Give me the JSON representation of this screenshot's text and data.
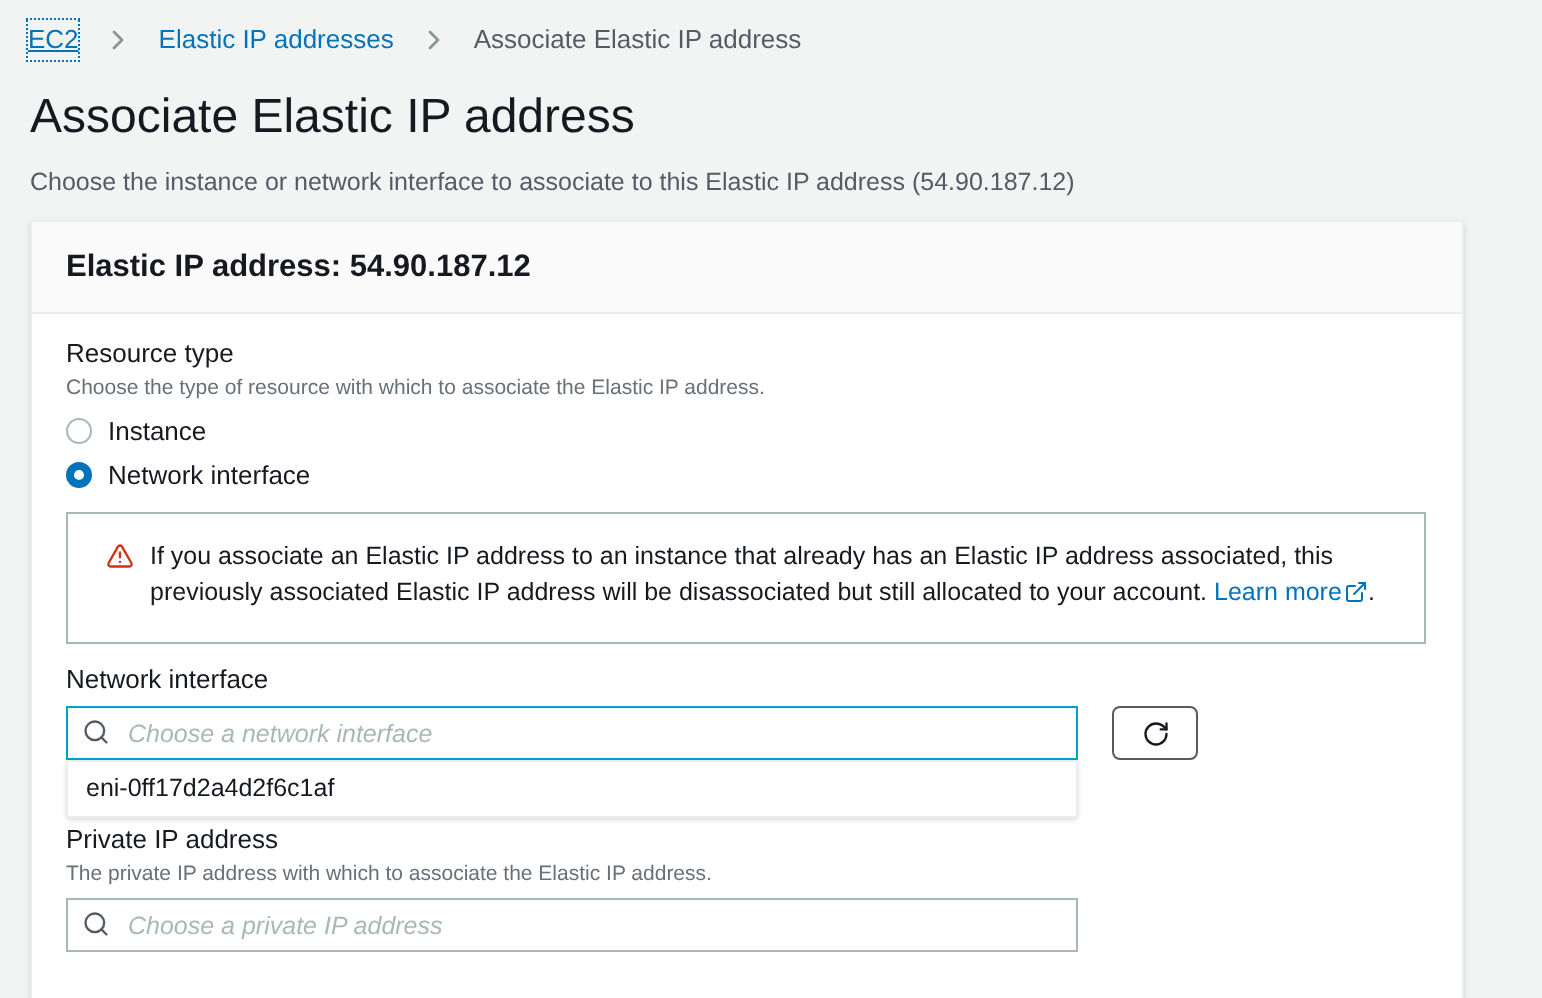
{
  "breadcrumbs": [
    {
      "label": "EC2",
      "kind": "link"
    },
    {
      "label": "Elastic IP addresses",
      "kind": "link"
    },
    {
      "label": "Associate Elastic IP address",
      "kind": "current"
    }
  ],
  "page": {
    "title": "Associate Elastic IP address",
    "description": "Choose the instance or network interface to associate to this Elastic IP address (54.90.187.12)"
  },
  "card": {
    "title": "Elastic IP address: 54.90.187.12"
  },
  "resource_type": {
    "label": "Resource type",
    "description": "Choose the type of resource with which to associate the Elastic IP address.",
    "options": [
      {
        "label": "Instance",
        "selected": false
      },
      {
        "label": "Network interface",
        "selected": true
      }
    ]
  },
  "warning": {
    "text": "If you associate an Elastic IP address to an instance that already has an Elastic IP address associated, this previously associated Elastic IP address will be disassociated but still allocated to your account.",
    "link": "Learn more",
    "after_link": "."
  },
  "network_interface": {
    "label": "Network interface",
    "placeholder": "Choose a network interface",
    "options": [
      "eni-0ff17d2a4d2f6c1af"
    ]
  },
  "private_ip": {
    "label": "Private IP address",
    "description": "The private IP address with which to associate the Elastic IP address.",
    "placeholder": "Choose a private IP address"
  }
}
